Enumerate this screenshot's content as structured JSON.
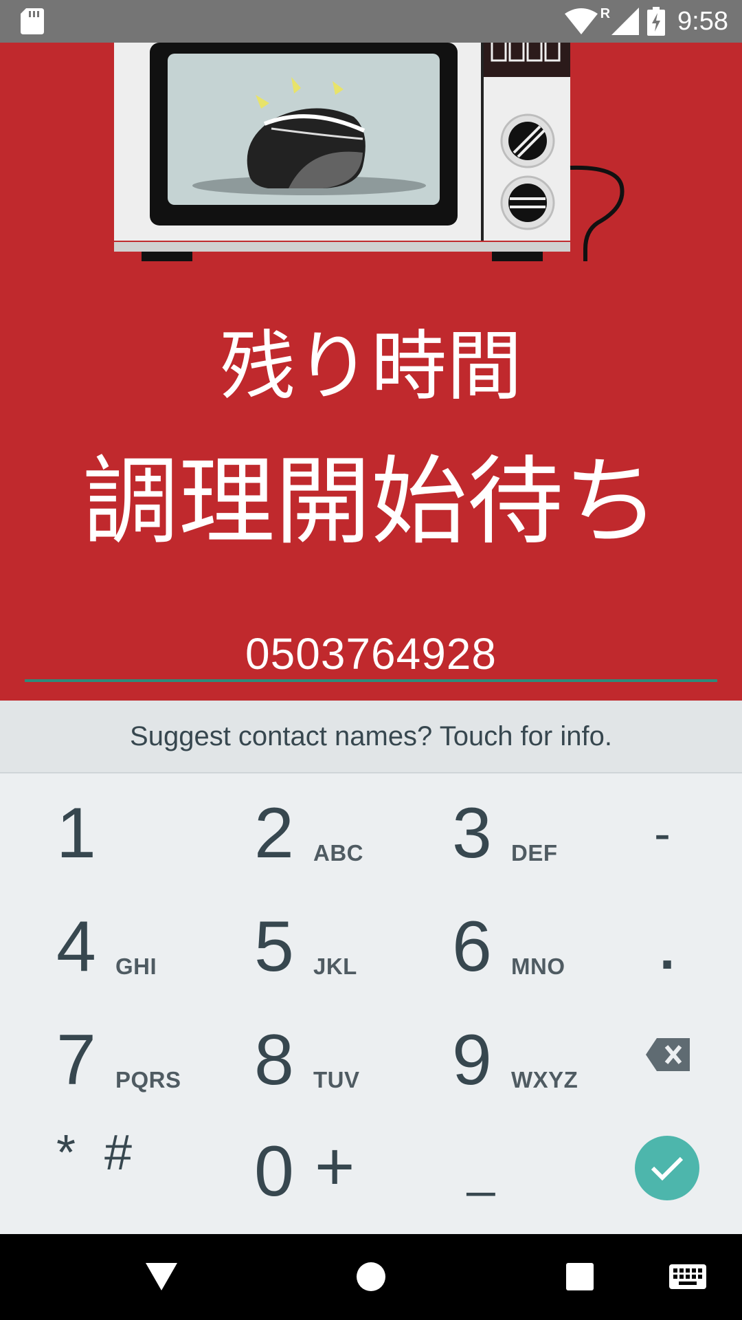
{
  "status_bar": {
    "time": "9:58",
    "icons": [
      "sd-card-icon",
      "wifi-icon",
      "roaming-indicator-icon",
      "cell-signal-icon",
      "battery-charging-icon"
    ],
    "roaming_label": "R"
  },
  "app": {
    "background_color": "#c0292d",
    "illustration": "microwave-icon",
    "remaining_time_label": "残り時間",
    "cooking_status": "調理開始待ち",
    "phone_input_value": "0503764928",
    "input_underline_color": "#2e8b7a"
  },
  "keyboard": {
    "suggestion_text": "Suggest contact names? Touch for info.",
    "keys": [
      {
        "digit": "1",
        "letters": ""
      },
      {
        "digit": "2",
        "letters": "ABC"
      },
      {
        "digit": "3",
        "letters": "DEF"
      },
      {
        "digit": "4",
        "letters": "GHI"
      },
      {
        "digit": "5",
        "letters": "JKL"
      },
      {
        "digit": "6",
        "letters": "MNO"
      },
      {
        "digit": "7",
        "letters": "PQRS"
      },
      {
        "digit": "8",
        "letters": "TUV"
      },
      {
        "digit": "9",
        "letters": "WXYZ"
      },
      {
        "digit": "0",
        "letters": ""
      }
    ],
    "symbols": {
      "dash": "-",
      "period": ".",
      "star": "*",
      "hash": "#",
      "plus": "+",
      "space": "_"
    },
    "backspace_icon": "backspace-icon",
    "done_icon": "checkmark-icon",
    "done_color": "#4db6ac"
  },
  "nav_bar": {
    "icons": [
      "back-icon",
      "home-icon",
      "recents-icon",
      "keyboard-switch-icon"
    ]
  }
}
